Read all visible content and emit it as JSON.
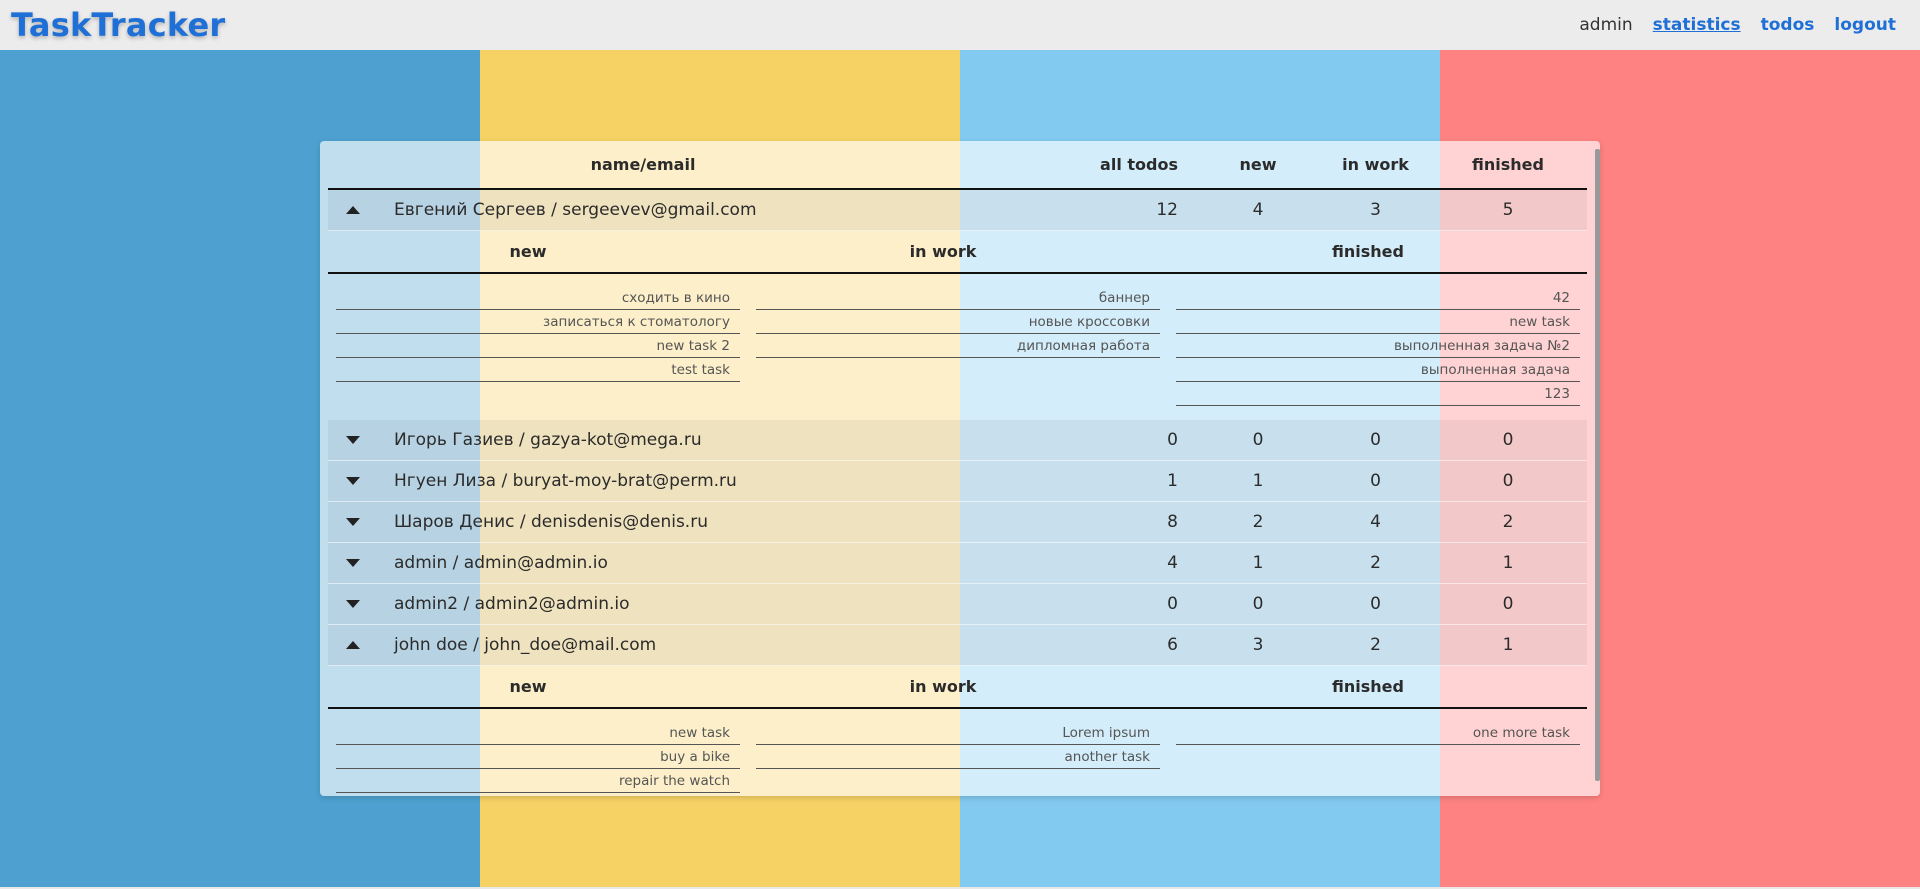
{
  "header": {
    "logo": "TaskTracker",
    "user": "admin",
    "nav": [
      "statistics",
      "todos",
      "logout"
    ]
  },
  "background_colors": [
    "#4ea0d0",
    "#f6d264",
    "#82caf0",
    "#fe8282"
  ],
  "table": {
    "headers": {
      "name": "name/email",
      "all": "all todos",
      "new": "new",
      "in_work": "in work",
      "finished": "finished"
    },
    "detail_headers": {
      "new": "new",
      "in_work": "in work",
      "finished": "finished"
    },
    "users": [
      {
        "name": "Евгений Сергеев / sergeevev@gmail.com",
        "all": "12",
        "new": "4",
        "in_work": "3",
        "finished": "5",
        "expanded": true,
        "tasks": {
          "new": [
            "сходить в кино",
            "записаться к стоматологу",
            "new task 2",
            "test task"
          ],
          "in_work": [
            "баннер",
            "новые кроссовки",
            "дипломная работа"
          ],
          "finished": [
            "42",
            "new task",
            "выполненная задача №2",
            "выполненная задача",
            "123"
          ]
        }
      },
      {
        "name": "Игорь Газиев / gazya-kot@mega.ru",
        "all": "0",
        "new": "0",
        "in_work": "0",
        "finished": "0",
        "expanded": false
      },
      {
        "name": "Нгуен Лиза / buryat-moy-brat@perm.ru",
        "all": "1",
        "new": "1",
        "in_work": "0",
        "finished": "0",
        "expanded": false
      },
      {
        "name": "Шаров Денис / denisdenis@denis.ru",
        "all": "8",
        "new": "2",
        "in_work": "4",
        "finished": "2",
        "expanded": false
      },
      {
        "name": "admin / admin@admin.io",
        "all": "4",
        "new": "1",
        "in_work": "2",
        "finished": "1",
        "expanded": false
      },
      {
        "name": "admin2 / admin2@admin.io",
        "all": "0",
        "new": "0",
        "in_work": "0",
        "finished": "0",
        "expanded": false
      },
      {
        "name": "john doe / john_doe@mail.com",
        "all": "6",
        "new": "3",
        "in_work": "2",
        "finished": "1",
        "expanded": true,
        "tasks": {
          "new": [
            "new task",
            "buy a bike",
            "repair the watch"
          ],
          "in_work": [
            "Lorem ipsum",
            "another task"
          ],
          "finished": [
            "one more task"
          ]
        }
      }
    ]
  }
}
